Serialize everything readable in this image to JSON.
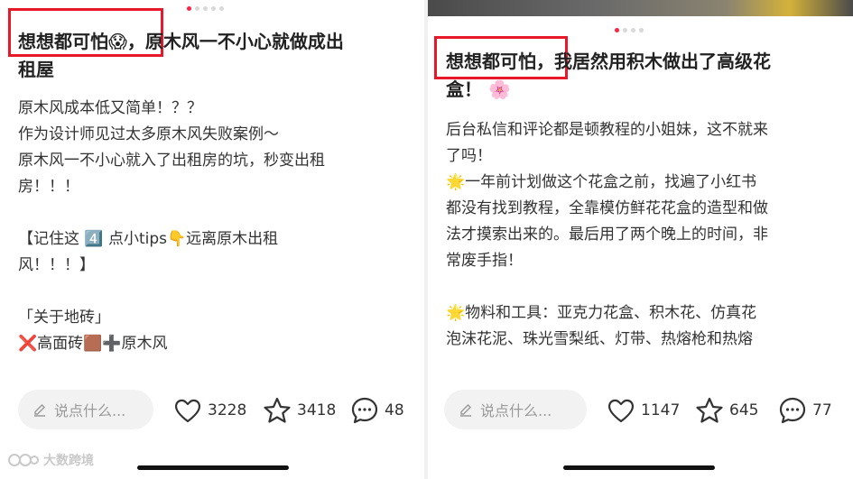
{
  "left": {
    "title_lines": [
      "想想都可怕😱，原木风一不小心就做成出",
      "租屋"
    ],
    "body": "原木风成本低又简单！？？\n作为设计师见过太多原木风失败案例～\n原木风一不小心就入了出租房的坑，秒变出租\n房！！！\n\n【记住这 4️⃣ 点小tips👇远离原木出租\n风！！！】\n\n「关于地砖」\n❌高面砖🟫➕原木风",
    "comment_placeholder": "说点什么...",
    "likes": "3228",
    "stars": "3418",
    "comments": "48"
  },
  "right": {
    "title_lines": [
      "想想都可怕，我居然用积木做出了高级花",
      "盒！ 🌸"
    ],
    "body": "后台私信和评论都是顿教程的小姐妹，这不就来\n了吗！\n🌟一年前计划做这个花盒之前，找遍了小红书\n都没有找到教程，全靠模仿鲜花花盒的造型和做\n法才摸索出来的。最后用了两个晚上的时间，非\n常废手指！\n\n🌟物料和工具：亚克力花盒、积木花、仿真花\n泡沫花泥、珠光雪梨纸、灯带、热熔枪和热熔",
    "comment_placeholder": "说点什么...",
    "likes": "1147",
    "stars": "645",
    "comments": "77"
  },
  "watermark": "大数跨境",
  "colors": {
    "accent": "#ff2442",
    "highlight_box": "#e8182a"
  },
  "icons": [
    "pencil-icon",
    "heart-icon",
    "star-icon",
    "comment-bubble-icon"
  ]
}
